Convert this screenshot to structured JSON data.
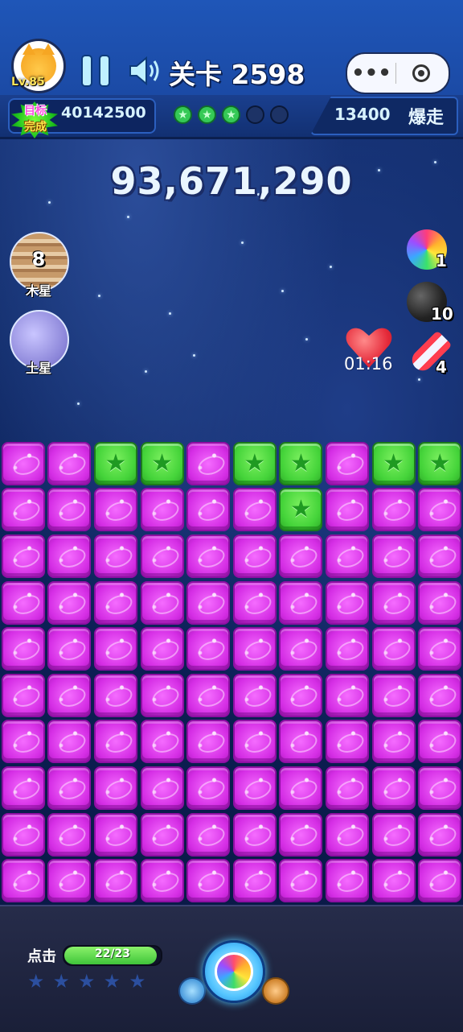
{
  "header": {
    "player_level": "Lv.85",
    "level_title": "关卡 2598",
    "capsule_menu": "•••",
    "goal_badge_line1": "目标",
    "goal_badge_line2": "完成",
    "goal_score": "40142500",
    "progress_stars_earned": 3,
    "progress_stars_total": 5,
    "boost_score": "13400",
    "boost_label": "爆走"
  },
  "score": "93,671,290",
  "objectives": [
    {
      "name": "木星",
      "count": "8",
      "icon": "jupiter-planet"
    },
    {
      "name": "土星",
      "count": "",
      "icon": "saturn-planet"
    }
  ],
  "powerups": [
    {
      "icon": "rainbow-planet-icon",
      "count": "1"
    },
    {
      "icon": "bomb-icon",
      "count": "10"
    },
    {
      "icon": "rocket-icon",
      "count": "4"
    }
  ],
  "gift_timer": "01:16",
  "board": {
    "columns": 10,
    "rows": 10,
    "cells": [
      [
        "m",
        "m",
        "g",
        "g",
        "m",
        "g",
        "g",
        "m",
        "g",
        "g"
      ],
      [
        "m",
        "m",
        "m",
        "m",
        "m",
        "m",
        "g",
        "m",
        "m",
        "m"
      ],
      [
        "m",
        "m",
        "m",
        "m",
        "m",
        "m",
        "m",
        "m",
        "m",
        "m"
      ],
      [
        "m",
        "m",
        "m",
        "m",
        "m",
        "m",
        "m",
        "m",
        "m",
        "m"
      ],
      [
        "m",
        "m",
        "m",
        "m",
        "m",
        "m",
        "m",
        "m",
        "m",
        "m"
      ],
      [
        "m",
        "m",
        "m",
        "m",
        "m",
        "m",
        "m",
        "m",
        "m",
        "m"
      ],
      [
        "m",
        "m",
        "m",
        "m",
        "m",
        "m",
        "m",
        "m",
        "m",
        "m"
      ],
      [
        "m",
        "m",
        "m",
        "m",
        "m",
        "m",
        "m",
        "m",
        "m",
        "m"
      ],
      [
        "m",
        "m",
        "m",
        "m",
        "m",
        "m",
        "m",
        "m",
        "m",
        "m"
      ],
      [
        "m",
        "m",
        "m",
        "m",
        "m",
        "m",
        "m",
        "m",
        "m",
        "m"
      ]
    ],
    "colors": {
      "m": "#d52ee5",
      "g": "#45d43a"
    }
  },
  "footer": {
    "tap_label": "点击",
    "taps_text": "22/23",
    "taps_used": 22,
    "taps_total": 23,
    "stars_total": 5
  }
}
